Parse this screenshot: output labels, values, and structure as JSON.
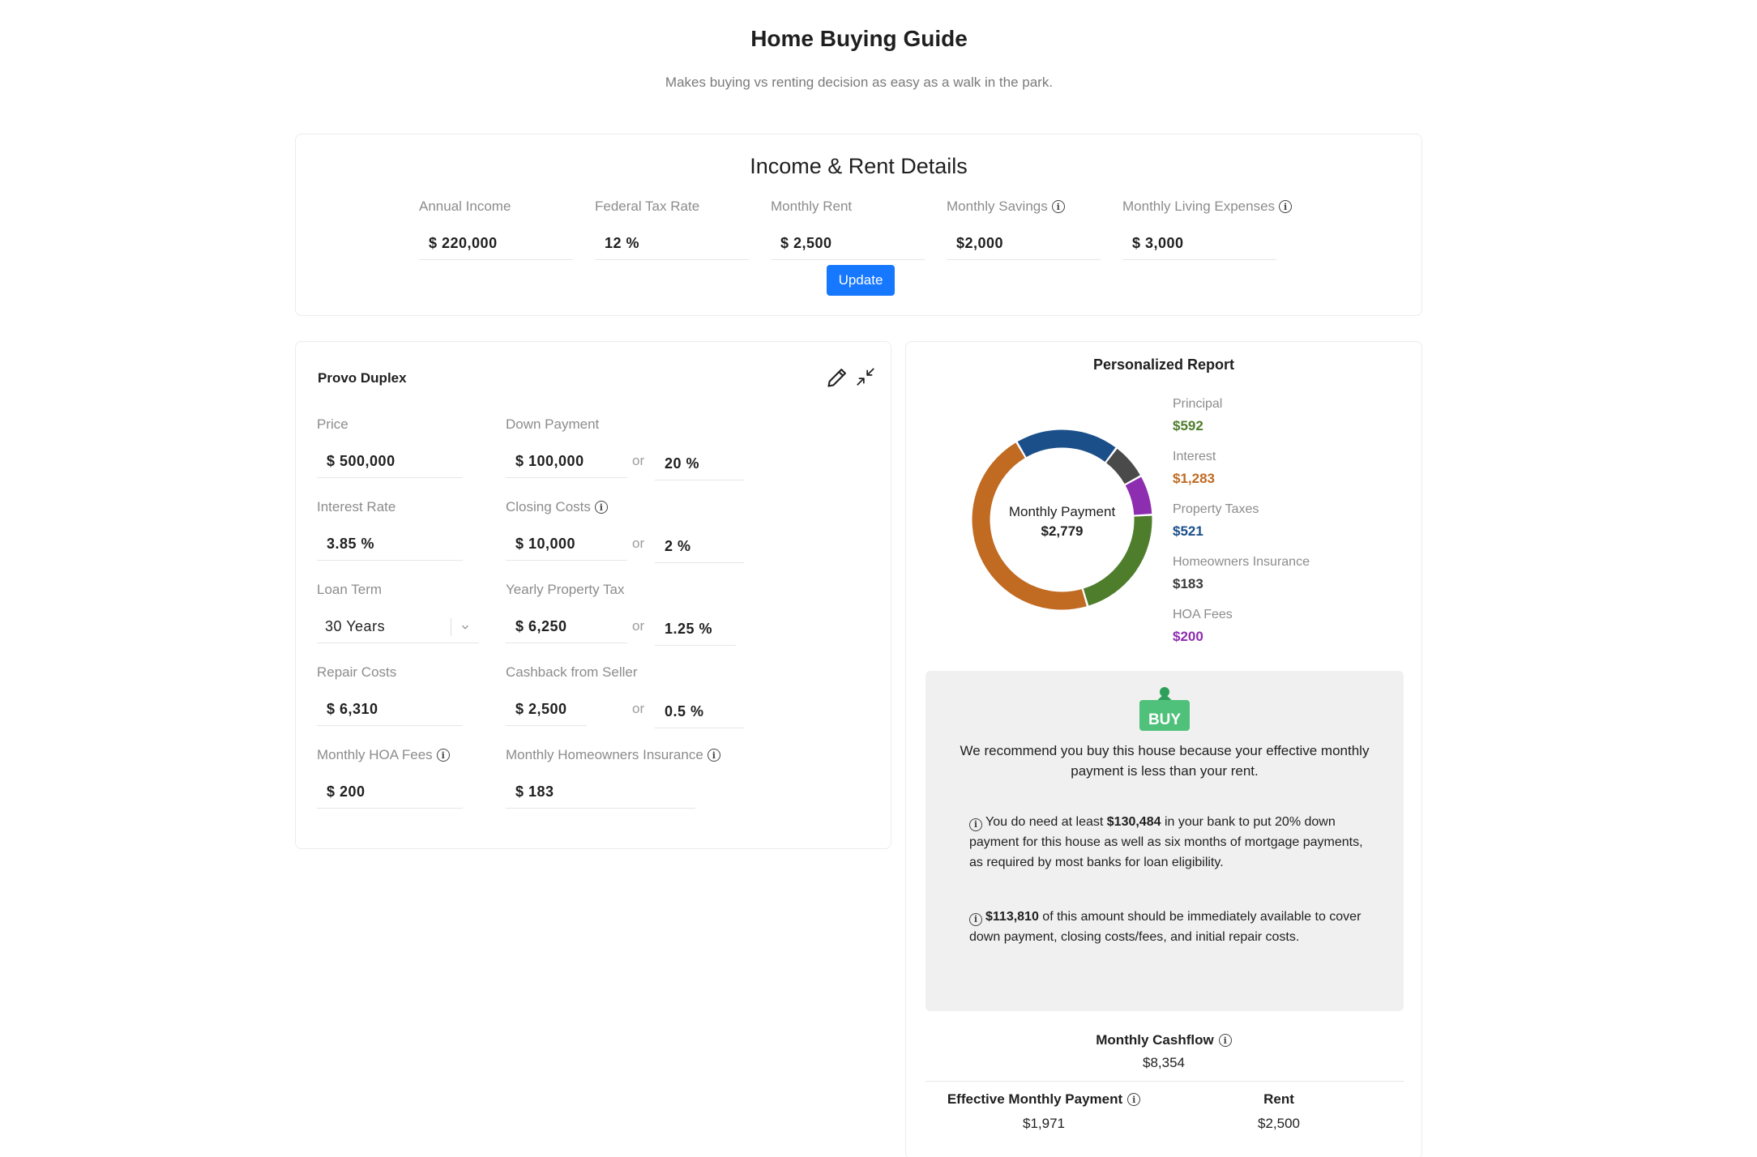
{
  "page": {
    "title": "Home Buying Guide",
    "subtitle": "Makes buying vs renting decision as easy as a walk in the park."
  },
  "income": {
    "title": "Income & Rent Details",
    "fields": [
      {
        "label": "Annual Income",
        "value": "$ 220,000"
      },
      {
        "label": "Federal Tax Rate",
        "value": "12 %"
      },
      {
        "label": "Monthly Rent",
        "value": "$ 2,500"
      },
      {
        "label": "Monthly Savings",
        "value": "$2,000"
      },
      {
        "label": "Monthly Living Expenses",
        "value": "$ 3,000"
      }
    ],
    "update_label": "Update"
  },
  "property": {
    "name": "Provo Duplex",
    "price": {
      "label": "Price",
      "value": "$ 500,000"
    },
    "down_payment": {
      "label": "Down Payment",
      "value": "$ 100,000",
      "or": "or",
      "percent": "20 %"
    },
    "interest_rate": {
      "label": "Interest Rate",
      "value": "3.85 %"
    },
    "closing_costs": {
      "label": "Closing Costs",
      "value": "$ 10,000",
      "or": "or",
      "percent": "2 %"
    },
    "loan_term": {
      "label": "Loan Term",
      "value": "30 Years"
    },
    "property_tax": {
      "label": "Yearly Property Tax",
      "value": "$ 6,250",
      "or": "or",
      "percent": "1.25 %"
    },
    "repair_costs": {
      "label": "Repair Costs",
      "value": "$ 6,310"
    },
    "cashback": {
      "label": "Cashback from Seller",
      "value": "$ 2,500",
      "or": "or",
      "percent": "0.5 %"
    },
    "hoa": {
      "label": "Monthly HOA Fees",
      "value": "$ 200"
    },
    "insurance": {
      "label": "Monthly Homeowners Insurance",
      "value": "$ 183"
    }
  },
  "report": {
    "title": "Personalized Report",
    "center_label": "Monthly Payment",
    "center_value": "$2,779",
    "legend": [
      {
        "label": "Principal",
        "value": "$592",
        "color": "#4e7d2c"
      },
      {
        "label": "Interest",
        "value": "$1,283",
        "color": "#c06a22"
      },
      {
        "label": "Property Taxes",
        "value": "$521",
        "color": "#1b4f8a"
      },
      {
        "label": "Homeowners Insurance",
        "value": "$183",
        "color": "#4a4a4a"
      },
      {
        "label": "HOA Fees",
        "value": "$200",
        "color": "#8d2db0"
      }
    ],
    "badge": "BUY",
    "recommendation": "We recommend you buy this house because your effective monthly payment is less than your rent.",
    "note1_amount": "$130,484",
    "note1_pre": "You do need at least ",
    "note1_post": " in your bank to put 20% down payment for this house as well as six months of mortgage payments, as required by most banks for loan eligibility.",
    "note2_amount": "$113,810",
    "note2_post": " of this amount should be immediately available to cover down payment, closing costs/fees, and initial repair costs.",
    "cashflow_label": "Monthly Cashflow",
    "cashflow_value": "$8,354",
    "effective_label": "Effective Monthly Payment",
    "effective_value": "$1,971",
    "rent_label": "Rent",
    "rent_value": "$2,500"
  }
}
